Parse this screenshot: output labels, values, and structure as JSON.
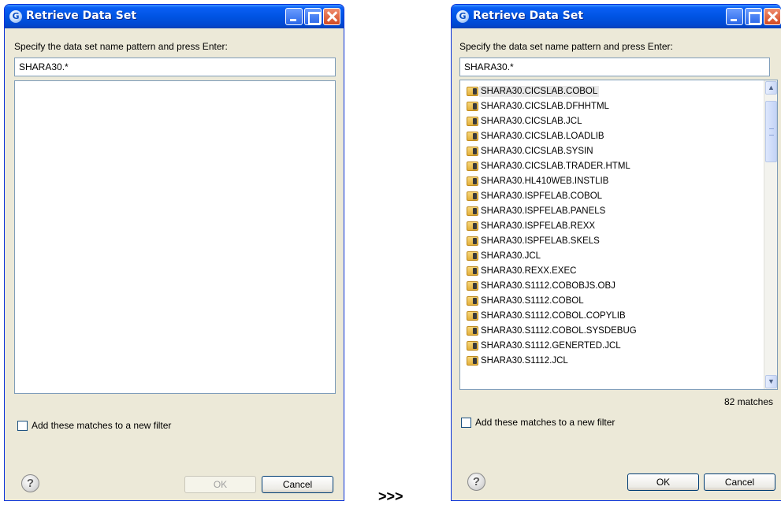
{
  "dialog_title": "Retrieve Data Set",
  "prompt": "Specify the data set name pattern and press Enter:",
  "pattern": "SHARA30.*",
  "checkbox_label": "Add these matches to a new filter",
  "ok_label": "OK",
  "cancel_label": "Cancel",
  "help_label": "?",
  "arrow": ">>>",
  "matches": "82 matches",
  "results": [
    "SHARA30.CICSLAB.COBOL",
    "SHARA30.CICSLAB.DFHHTML",
    "SHARA30.CICSLAB.JCL",
    "SHARA30.CICSLAB.LOADLIB",
    "SHARA30.CICSLAB.SYSIN",
    "SHARA30.CICSLAB.TRADER.HTML",
    "SHARA30.HL410WEB.INSTLIB",
    "SHARA30.ISPFELAB.COBOL",
    "SHARA30.ISPFELAB.PANELS",
    "SHARA30.ISPFELAB.REXX",
    "SHARA30.ISPFELAB.SKELS",
    "SHARA30.JCL",
    "SHARA30.REXX.EXEC",
    "SHARA30.S1112.COBOBJS.OBJ",
    "SHARA30.S1112.COBOL",
    "SHARA30.S1112.COBOL.COPYLIB",
    "SHARA30.S1112.COBOL.SYSDEBUG",
    "SHARA30.S1112.GENERTED.JCL",
    "SHARA30.S1112.JCL"
  ],
  "selected_index": 0,
  "colors": {
    "titlebar": "#0054e3",
    "dialog_bg": "#ece9d8",
    "field_border": "#7f9db9"
  }
}
